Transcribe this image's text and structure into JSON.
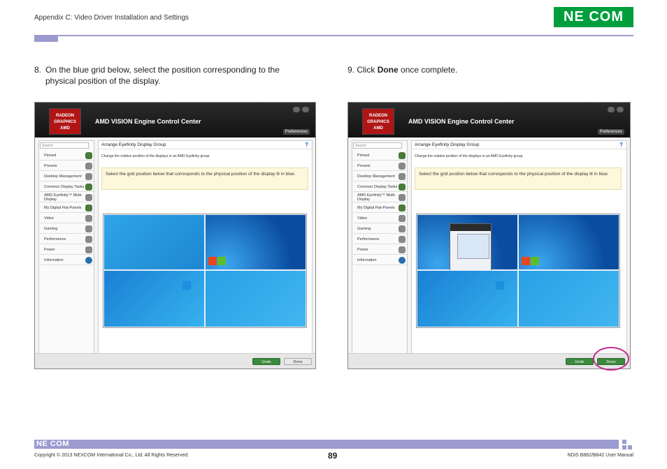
{
  "header": {
    "title": "Appendix C: Video Driver Installation and Settings",
    "brand": "NE COM"
  },
  "steps": {
    "step8_num": "8.",
    "step8_text": "On the blue grid below, select the position corresponding to the physical position of the display.",
    "step9_prefix": "9. Click ",
    "step9_bold": "Done",
    "step9_suffix": " once complete."
  },
  "app": {
    "title": "AMD VISION Engine Control Center",
    "badge_line1": "RADEON",
    "badge_line2": "GRAPHICS",
    "badge_line3": "AMD",
    "preferences": "Preferences",
    "search_placeholder": "Search",
    "nav": [
      "Pinned",
      "Presets",
      "Desktop Management",
      "Common Display Tasks",
      "AMD Eyefinity™ Multi-Display",
      "My Digital Flat-Panels",
      "Video",
      "Gaming",
      "Performance",
      "Power",
      "Information"
    ],
    "section_title": "Arrange Eyefinity Display Group",
    "description": "Change the relative position of the displays in an AMD Eyefinity group.",
    "note": "Select the grid position below that corresponds to the physical position of the display lit in blue.",
    "undo": "Undo",
    "done": "Done"
  },
  "footer": {
    "brand": "NE COM",
    "copyright": "Copyright © 2013 NEXCOM International Co., Ltd. All Rights Reserved.",
    "page": "89",
    "manual": "NDiS B862/B842 User Manual"
  }
}
